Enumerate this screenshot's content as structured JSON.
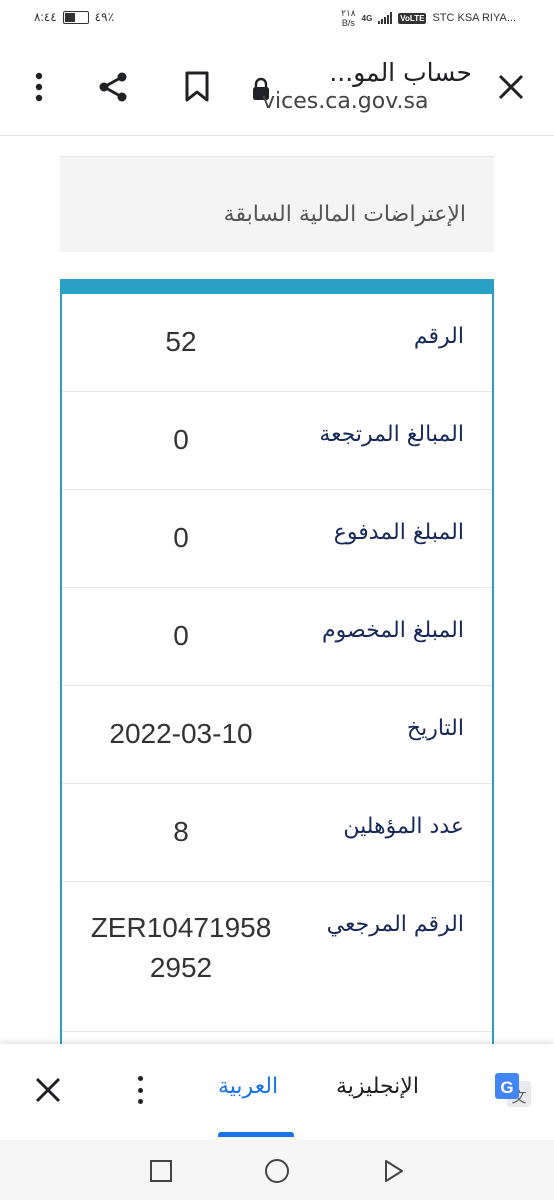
{
  "status_bar": {
    "time": "٨:٤٤",
    "battery": "٤٩٪",
    "net_speed": "٢١٨",
    "net_unit": "B/s",
    "network": "4G",
    "volte": "VoLTE",
    "carrier": "STC KSA RIYA..."
  },
  "browser": {
    "page_title": "حساب المو...",
    "url": "vices.ca.gov.sa"
  },
  "section": {
    "title": "الإعتراضات المالية السابقة"
  },
  "record": {
    "rows": [
      {
        "label": "الرقم",
        "value": "52"
      },
      {
        "label": "المبالغ المرتجعة",
        "value": "0"
      },
      {
        "label": "المبلغ المدفوع",
        "value": "0"
      },
      {
        "label": "المبلغ المخصوم",
        "value": "0"
      },
      {
        "label": "التاريخ",
        "value": "2022-03-10"
      },
      {
        "label": "عدد المؤهلين",
        "value": "8"
      },
      {
        "label": "الرقم المرجعي",
        "value": "ZER104719582952"
      }
    ]
  },
  "translate_bar": {
    "active_language": "العربية",
    "other_language": "الإنجليزية"
  },
  "colors": {
    "accent": "#2aa1c4",
    "label_text": "#17295a",
    "translate_blue": "#1a73e8"
  }
}
